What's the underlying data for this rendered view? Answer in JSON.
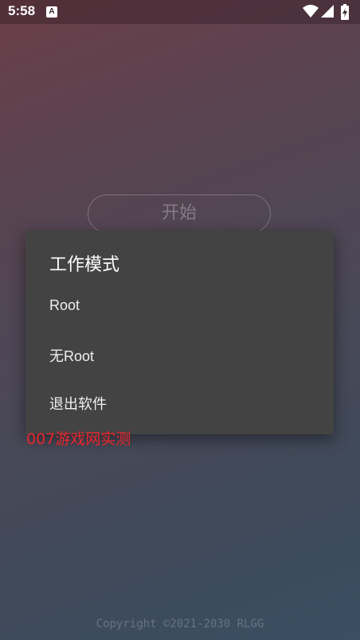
{
  "status_bar": {
    "time": "5:58",
    "notification_icon": "a-notification-icon",
    "icons": [
      "wifi-icon",
      "signal-icon",
      "battery-charging-icon"
    ]
  },
  "main": {
    "start_label": "开始"
  },
  "dialog": {
    "title": "工作模式",
    "items": [
      {
        "label": "Root"
      },
      {
        "label": "无Root"
      },
      {
        "label": "退出软件"
      }
    ]
  },
  "watermark": "007游戏网实测",
  "footer": {
    "copyright": "Copyright ©2021-2030 RLGG"
  },
  "colors": {
    "dialog_bg": "#434343",
    "watermark": "#e8262a"
  }
}
